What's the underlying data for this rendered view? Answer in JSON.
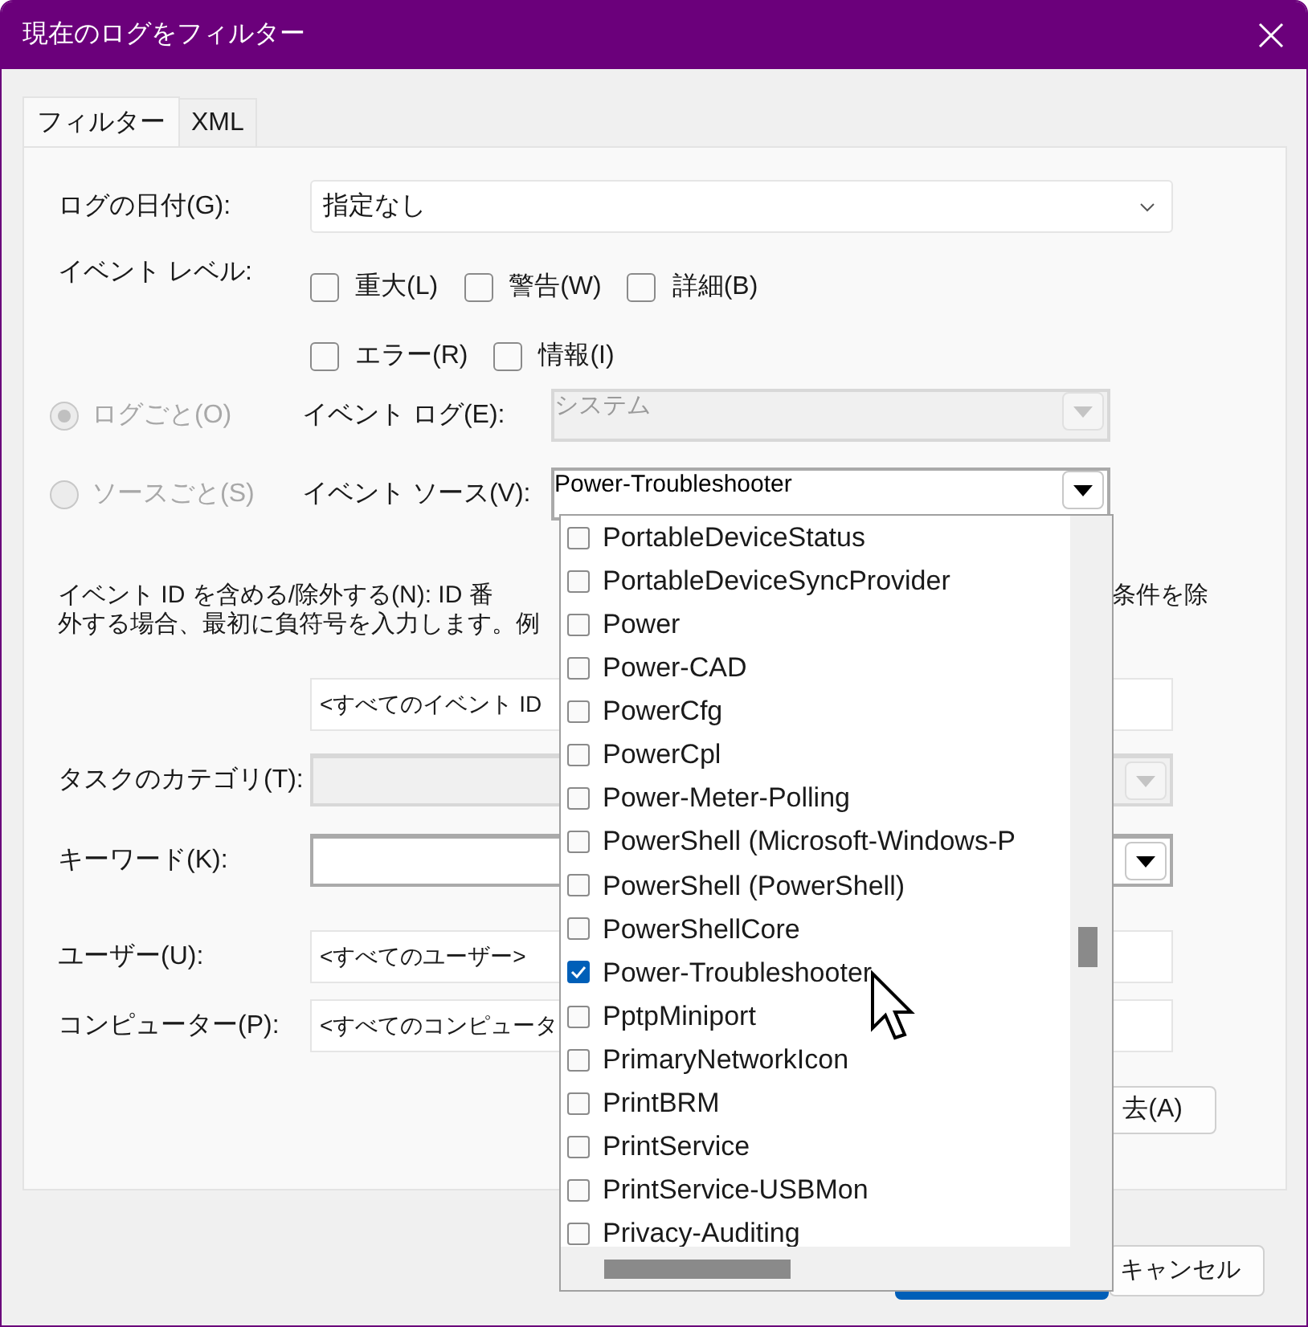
{
  "window": {
    "title": "現在のログをフィルター"
  },
  "tabs": [
    {
      "label": "フィルター",
      "selected": true
    },
    {
      "label": "XML",
      "selected": false
    }
  ],
  "date": {
    "label": "ログの日付(G):",
    "value": "指定なし"
  },
  "event_level": {
    "label": "イベント レベル:",
    "options": [
      {
        "label": "重大(L)",
        "checked": false
      },
      {
        "label": "警告(W)",
        "checked": false
      },
      {
        "label": "詳細(B)",
        "checked": false
      },
      {
        "label": "エラー(R)",
        "checked": false
      },
      {
        "label": "情報(I)",
        "checked": false
      }
    ]
  },
  "scope": [
    {
      "label": "ログごと(O)",
      "selected": true,
      "disabled": true,
      "field_label": "イベント ログ(E):",
      "value": "システム",
      "field_disabled": true
    },
    {
      "label": "ソースごと(S)",
      "selected": false,
      "disabled": true,
      "field_label": "イベント ソース(V):",
      "value": "Power-Troubleshooter",
      "field_disabled": false
    }
  ],
  "event_id": {
    "description_left": [
      "イベント ID を含める/除外する(N): ID 番",
      "外する場合、最初に負符号を入力します。例"
    ],
    "description_right": "条件を除",
    "value": "<すべてのイベント ID"
  },
  "task_category": {
    "label": "タスクのカテゴリ(T):",
    "disabled": true
  },
  "keywords": {
    "label": "キーワード(K):",
    "disabled": false
  },
  "user": {
    "label": "ユーザー(U):",
    "value": "<すべてのユーザー>"
  },
  "computer": {
    "label": "コンピューター(P):",
    "value": "<すべてのコンピュータ"
  },
  "clear_button": "去(A)",
  "cancel_button": "キャンセル",
  "source_list": [
    {
      "label": "PortableDeviceStatus",
      "checked": false
    },
    {
      "label": "PortableDeviceSyncProvider",
      "checked": false
    },
    {
      "label": "Power",
      "checked": false
    },
    {
      "label": "Power-CAD",
      "checked": false
    },
    {
      "label": "PowerCfg",
      "checked": false
    },
    {
      "label": "PowerCpl",
      "checked": false
    },
    {
      "label": "Power-Meter-Polling",
      "checked": false
    },
    {
      "label": "PowerShell (Microsoft-Windows-P",
      "checked": false
    },
    {
      "label": "PowerShell (PowerShell)",
      "checked": false
    },
    {
      "label": "PowerShellCore",
      "checked": false
    },
    {
      "label": "Power-Troubleshooter",
      "checked": true
    },
    {
      "label": "PptpMiniport",
      "checked": false
    },
    {
      "label": "PrimaryNetworkIcon",
      "checked": false
    },
    {
      "label": "PrintBRM",
      "checked": false
    },
    {
      "label": "PrintService",
      "checked": false
    },
    {
      "label": "PrintService-USBMon",
      "checked": false
    },
    {
      "label": "Privacy-Auditing",
      "checked": false
    }
  ]
}
